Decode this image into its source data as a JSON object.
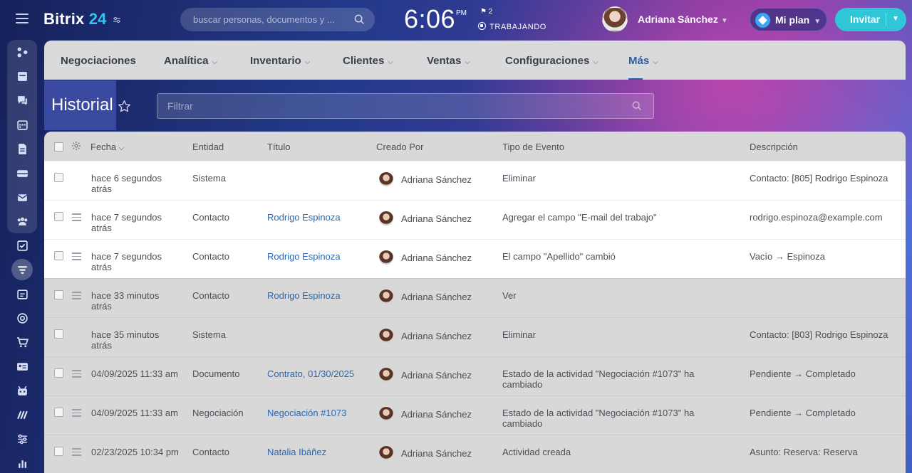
{
  "header": {
    "logo_main": "Bitrix",
    "logo_num": "24",
    "search_placeholder": "buscar personas, documentos y ...",
    "time": "6:06",
    "time_suffix": "PM",
    "flag_count": "2",
    "work_status": "TRABAJANDO",
    "user_name": "Adriana Sánchez",
    "plan_label": "Mi plan",
    "invite_label": "Invitar"
  },
  "nav": {
    "items": [
      {
        "label": "Negociaciones",
        "chevron": false
      },
      {
        "label": "Analítica",
        "chevron": true
      },
      {
        "label": "Inventario",
        "chevron": true
      },
      {
        "label": "Clientes",
        "chevron": true
      },
      {
        "label": "Ventas",
        "chevron": true
      },
      {
        "label": "Configuraciones",
        "chevron": true
      },
      {
        "label": "Más",
        "chevron": true
      }
    ],
    "active": "Más"
  },
  "page": {
    "title": "Historial",
    "filter_placeholder": "Filtrar"
  },
  "grid": {
    "columns": [
      "Fecha",
      "Entidad",
      "Título",
      "Creado Por",
      "Tipo de Evento",
      "Descripción"
    ],
    "rows": [
      {
        "fecha": "hace 6 segundos atrás",
        "entidad": "Sistema",
        "titulo": "",
        "creado": "Adriana Sánchez",
        "tipo": "Eliminar",
        "desc": "Contacto: [805] Rodrigo Espinoza",
        "highlight": true,
        "drag": false
      },
      {
        "fecha": "hace 7 segundos atrás",
        "entidad": "Contacto",
        "titulo": "Rodrigo Espinoza",
        "creado": "Adriana Sánchez",
        "tipo": "Agregar el campo \"E-mail del trabajo\"",
        "desc": "rodrigo.espinoza@example.com",
        "highlight": true,
        "drag": true
      },
      {
        "fecha": "hace 7 segundos atrás",
        "entidad": "Contacto",
        "titulo": "Rodrigo Espinoza",
        "creado": "Adriana Sánchez",
        "tipo": "El campo \"Apellido\" cambió",
        "desc": "Vacío → Espinoza",
        "highlight": true,
        "drag": true
      },
      {
        "fecha": "hace 33 minutos atrás",
        "entidad": "Contacto",
        "titulo": "Rodrigo Espinoza",
        "creado": "Adriana Sánchez",
        "tipo": "Ver",
        "desc": "",
        "highlight": false,
        "drag": true
      },
      {
        "fecha": "hace 35 minutos atrás",
        "entidad": "Sistema",
        "titulo": "",
        "creado": "Adriana Sánchez",
        "tipo": "Eliminar",
        "desc": "Contacto: [803] Rodrigo Espinoza",
        "highlight": false,
        "drag": false
      },
      {
        "fecha": "04/09/2025 11:33 am",
        "entidad": "Documento",
        "titulo": "Contrato, 01/30/2025",
        "creado": "Adriana Sánchez",
        "tipo": "Estado de la actividad \"Negociación #1073\" ha cambiado",
        "desc": "Pendiente → Completado",
        "highlight": false,
        "drag": true
      },
      {
        "fecha": "04/09/2025 11:33 am",
        "entidad": "Negociación",
        "titulo": "Negociación #1073",
        "creado": "Adriana Sánchez",
        "tipo": "Estado de la actividad \"Negociación #1073\" ha cambiado",
        "desc": "Pendiente → Completado",
        "highlight": false,
        "drag": true
      },
      {
        "fecha": "02/23/2025 10:34 pm",
        "entidad": "Contacto",
        "titulo": "Natalia Ibáñez",
        "creado": "Adriana Sánchez",
        "tipo": "Actividad creada",
        "desc": "Asunto: Reserva: Reserva",
        "highlight": false,
        "drag": true
      }
    ]
  },
  "colors": {
    "accent": "#2f5ea8",
    "link": "#2a67b3",
    "invite": "#2fc6d8"
  }
}
